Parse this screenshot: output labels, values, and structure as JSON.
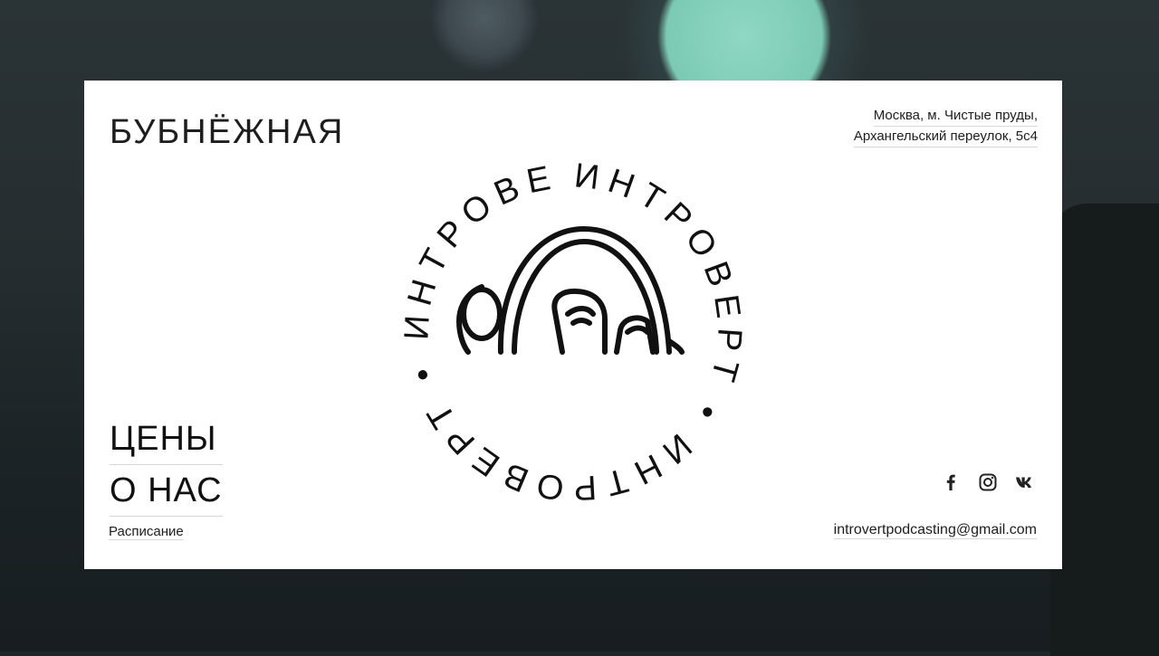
{
  "header": {
    "brand": "БУБНЁЖНАЯ",
    "address_line1": "Москва, м. Чистые пруды,",
    "address_line2": "Архангельский переулок, 5с4"
  },
  "logo": {
    "ring_text": "ИНТРОВЕРТ",
    "icon": "headphones-face-icon"
  },
  "nav": {
    "prices": "ЦЕНЫ",
    "about": "О НАС",
    "schedule": "Расписание"
  },
  "social": {
    "items": [
      "facebook-icon",
      "instagram-icon",
      "vk-icon"
    ]
  },
  "contact": {
    "email": "introvertpodcasting@gmail.com"
  },
  "colors": {
    "card_bg": "#ffffff",
    "text": "#1e1e1e",
    "accent_glow": "#7ccab3",
    "background": "#1f2629"
  }
}
